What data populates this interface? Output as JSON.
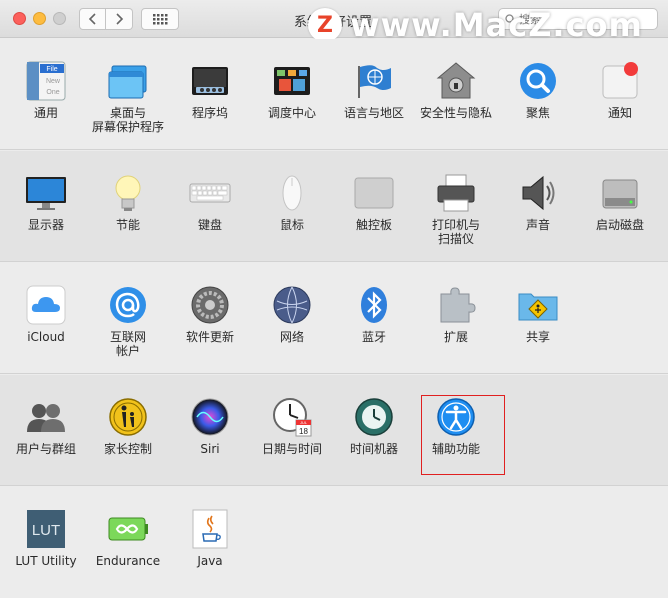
{
  "window": {
    "title": "系统偏好设置",
    "search_placeholder": "搜索"
  },
  "watermark": {
    "logo": "Z",
    "text": "www.MacZ.com"
  },
  "sections": [
    {
      "panes": [
        {
          "label": "通用",
          "icon": "general-icon"
        },
        {
          "label": "桌面与\n屏幕保护程序",
          "icon": "desktop-screensaver-icon"
        },
        {
          "label": "程序坞",
          "icon": "dock-icon"
        },
        {
          "label": "调度中心",
          "icon": "mission-control-icon"
        },
        {
          "label": "语言与地区",
          "icon": "language-region-icon"
        },
        {
          "label": "安全性与隐私",
          "icon": "security-privacy-icon"
        },
        {
          "label": "聚焦",
          "icon": "spotlight-icon"
        },
        {
          "label": "通知",
          "icon": "notifications-icon"
        }
      ]
    },
    {
      "panes": [
        {
          "label": "显示器",
          "icon": "displays-icon"
        },
        {
          "label": "节能",
          "icon": "energy-saver-icon"
        },
        {
          "label": "键盘",
          "icon": "keyboard-icon"
        },
        {
          "label": "鼠标",
          "icon": "mouse-icon"
        },
        {
          "label": "触控板",
          "icon": "trackpad-icon"
        },
        {
          "label": "打印机与\n扫描仪",
          "icon": "printers-scanners-icon"
        },
        {
          "label": "声音",
          "icon": "sound-icon"
        },
        {
          "label": "启动磁盘",
          "icon": "startup-disk-icon"
        }
      ]
    },
    {
      "panes": [
        {
          "label": "iCloud",
          "icon": "icloud-icon"
        },
        {
          "label": "互联网\n帐户",
          "icon": "internet-accounts-icon"
        },
        {
          "label": "软件更新",
          "icon": "software-update-icon"
        },
        {
          "label": "网络",
          "icon": "network-icon"
        },
        {
          "label": "蓝牙",
          "icon": "bluetooth-icon"
        },
        {
          "label": "扩展",
          "icon": "extensions-icon"
        },
        {
          "label": "共享",
          "icon": "sharing-icon"
        }
      ]
    },
    {
      "panes": [
        {
          "label": "用户与群组",
          "icon": "users-groups-icon"
        },
        {
          "label": "家长控制",
          "icon": "parental-controls-icon"
        },
        {
          "label": "Siri",
          "icon": "siri-icon"
        },
        {
          "label": "日期与时间",
          "icon": "date-time-icon"
        },
        {
          "label": "时间机器",
          "icon": "time-machine-icon"
        },
        {
          "label": "辅助功能",
          "icon": "accessibility-icon"
        }
      ]
    },
    {
      "panes": [
        {
          "label": "LUT Utility",
          "icon": "lut-utility-icon"
        },
        {
          "label": "Endurance",
          "icon": "endurance-icon"
        },
        {
          "label": "Java",
          "icon": "java-icon"
        }
      ]
    }
  ],
  "icon_text": {
    "general_file": "File",
    "general_new": "New",
    "general_one": "One",
    "lut": "LUT",
    "calendar_month": "JUL",
    "calendar_day": "18"
  },
  "colors": {
    "highlight": "#e02020",
    "accent": "#1f8ef1"
  }
}
